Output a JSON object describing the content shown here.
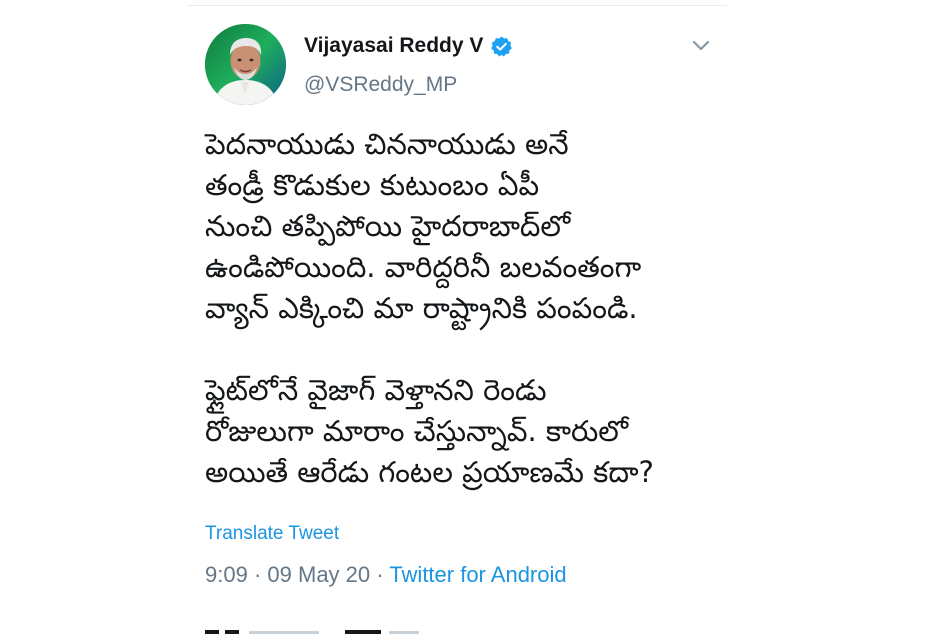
{
  "tweet": {
    "author": {
      "display_name": "Vijayasai Reddy V",
      "handle": "@VSReddy_MP",
      "verified": true
    },
    "text": {
      "paragraph1": [
        "పెదనాయుడు చిననాయుడు అనే",
        "తండ్రీ కొడుకుల కుటుంబం ఏపీ",
        "నుంచి తప్పిపోయి హైదరాబాద్‌లో",
        "ఉండిపోయింది. వారిద్దరినీ బలవంతంగా",
        "వ్యాన్ ఎక్కించి మా రాష్ట్రానికి పంపండి."
      ],
      "paragraph2": [
        "ఫ్లైట్‌లోనే వైజాగ్ వెళ్తానని రెండు",
        "రోజులుగా మారాం చేస్తున్నావ్. కారులో",
        "అయితే ఆరేడు గంటల ప్రయాణమే కదా?"
      ]
    },
    "translate_label": "Translate Tweet",
    "time": "9:09",
    "date": "09 May 20",
    "separator": "·",
    "source": "Twitter for Android"
  },
  "colors": {
    "link_blue": "#1b95e0",
    "secondary_gray": "#657786",
    "text_dark": "#14171a",
    "verified_blue": "#1da1f2"
  },
  "icons": {
    "verified": "verified-badge-icon",
    "more": "chevron-down-icon"
  }
}
